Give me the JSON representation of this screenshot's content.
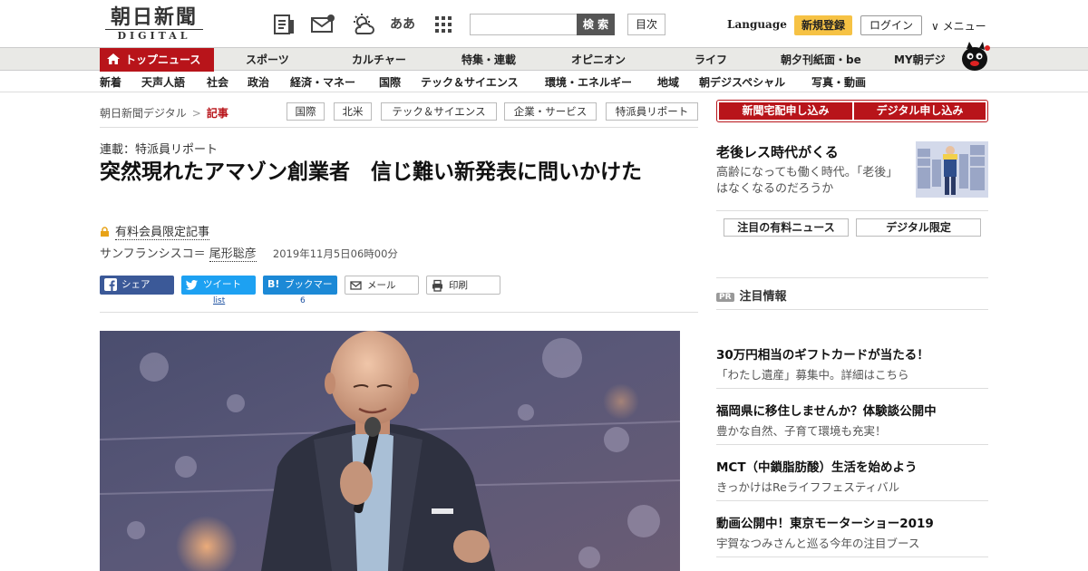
{
  "header": {
    "logo_main": "朝日新聞",
    "logo_sub": "DIGITAL",
    "icons": [
      "newspaper-icon",
      "envelope-icon",
      "weather-icon",
      "text-size-icon",
      "grid-icon"
    ],
    "text_size_label": "ああ",
    "search_placeholder": "",
    "search_label": "検 索",
    "toc_label": "目次",
    "language_label": "Language",
    "register_label": "新規登録",
    "login_label": "ログイン",
    "menu_label": "∨ メニュー"
  },
  "main_nav": {
    "active": "トップニュース",
    "items": [
      "スポーツ",
      "カルチャー",
      "特集・連載",
      "オピニオン",
      "ライフ",
      "朝夕刊紙面・be",
      "MY朝デジ"
    ]
  },
  "sub_nav": {
    "items": [
      "新着",
      "天声人語",
      "社会",
      "政治",
      "経済・マネー",
      "国際",
      "テック＆サイエンス",
      "環境・エネルギー",
      "地域",
      "朝デジスペシャル",
      "写真・動画"
    ]
  },
  "breadcrumb": {
    "root": "朝日新聞デジタル",
    "sep": ">",
    "current": "記事"
  },
  "tags": [
    "国際",
    "北米",
    "テック＆サイエンス",
    "企業・サービス",
    "特派員リポート"
  ],
  "article": {
    "series": "連載：特派員リポート",
    "title": "突然現れたアマゾン創業者　信じ難い新発表に問いかけた",
    "paid_label": "有料会員限定記事",
    "location": "サンフランシスコ＝",
    "author": "尾形聡彦",
    "date": "2019年11月5日06時00分"
  },
  "share": {
    "facebook": "シェア",
    "twitter": "ツイート",
    "hatena": "ブックマーク",
    "mail": "メール",
    "print": "印刷",
    "twitter_count": "list",
    "hatena_count": "6"
  },
  "sidebar": {
    "subscribe_paper": "新聞宅配申し込み",
    "subscribe_digital": "デジタル申し込み",
    "promo_title": "老後レス時代がくる",
    "promo_desc": "高齢になっても働く時代。「老後」はなくなるのだろうか",
    "tab_paid_news": "注目の有料ニュース",
    "tab_digital_only": "デジタル限定",
    "pr_badge": "PR",
    "pr_heading": "注目情報",
    "pr_items": [
      {
        "title": "30万円相当のギフトカードが当たる！",
        "desc": "「わたし遺産」募集中。詳細はこちら"
      },
      {
        "title": "福岡県に移住しませんか？体験談公開中",
        "desc": "豊かな自然、子育て環境も充実！"
      },
      {
        "title": "MCT（中鎖脂肪酸）生活を始めよう",
        "desc": "きっかけはReライフフェスティバル"
      },
      {
        "title": "動画公開中！東京モーターショー2019",
        "desc": "宇賀なつみさんと巡る今年の注目ブース"
      }
    ]
  },
  "colors": {
    "brand_red": "#b8141a",
    "register_yellow": "#f6c244",
    "facebook": "#3b5998",
    "twitter": "#1da1f2",
    "hatena": "#1c89d6"
  }
}
